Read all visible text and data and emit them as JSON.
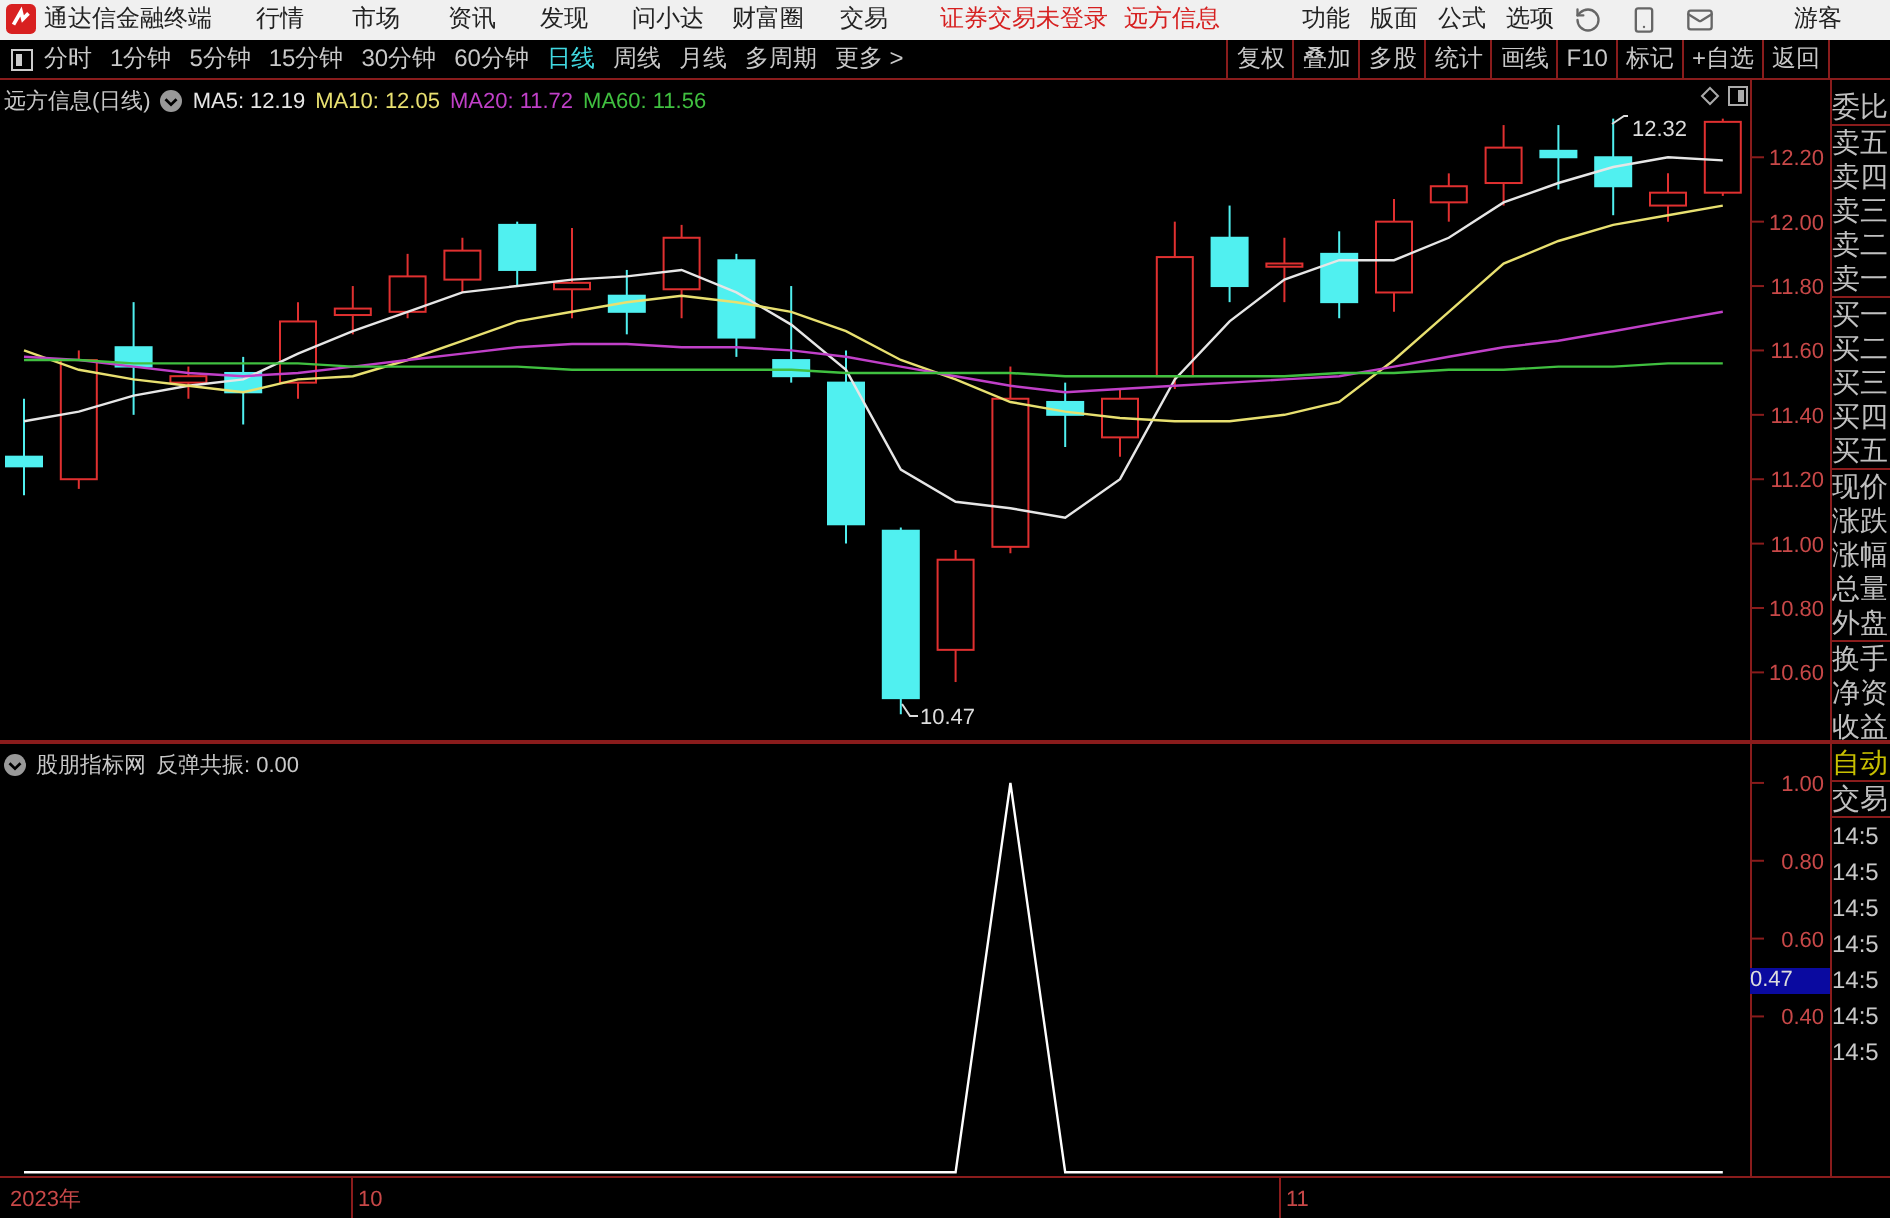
{
  "app": {
    "title": "通达信金融终端"
  },
  "menu": [
    "行情",
    "市场",
    "资讯",
    "发现",
    "问小达",
    "财富圈",
    "交易"
  ],
  "notices": [
    "证券交易未登录",
    "远方信息"
  ],
  "right_menu": [
    "功能",
    "版面",
    "公式",
    "选项"
  ],
  "user": "游客",
  "periods": [
    {
      "label": "分时",
      "selected": false
    },
    {
      "label": "1分钟",
      "selected": false
    },
    {
      "label": "5分钟",
      "selected": false
    },
    {
      "label": "15分钟",
      "selected": false
    },
    {
      "label": "30分钟",
      "selected": false
    },
    {
      "label": "60分钟",
      "selected": false
    },
    {
      "label": "日线",
      "selected": true
    },
    {
      "label": "周线",
      "selected": false
    },
    {
      "label": "月线",
      "selected": false
    },
    {
      "label": "多周期",
      "selected": false
    },
    {
      "label": "更多 >",
      "selected": false
    }
  ],
  "tools": [
    "复权",
    "叠加",
    "多股",
    "统计",
    "画线",
    "F10",
    "标记",
    "+自选",
    "返回"
  ],
  "chart": {
    "title": "远方信息(日线)",
    "high_label": "12.32",
    "low_label": "10.47",
    "chart_data": {
      "type": "line",
      "ylim": [
        10.39,
        12.44
      ],
      "yticks": [
        {
          "value": 12.2,
          "label": "12.20"
        },
        {
          "value": 12.0,
          "label": "12.00"
        },
        {
          "value": 11.8,
          "label": "11.80"
        },
        {
          "value": 11.6,
          "label": "11.60"
        },
        {
          "value": 11.4,
          "label": "11.40"
        },
        {
          "value": 11.2,
          "label": "11.20"
        },
        {
          "value": 11.0,
          "label": "11.00"
        },
        {
          "value": 10.8,
          "label": "10.80"
        },
        {
          "value": 10.6,
          "label": "10.60"
        }
      ],
      "series": [
        {
          "name": "MA5: 12.19",
          "color": "#e6e6e6",
          "values": [
            11.38,
            11.41,
            11.46,
            11.49,
            11.51,
            11.59,
            11.66,
            11.72,
            11.78,
            11.8,
            11.82,
            11.83,
            11.85,
            11.78,
            11.68,
            11.54,
            11.23,
            11.13,
            11.11,
            11.08,
            11.2,
            11.51,
            11.69,
            11.82,
            11.88,
            11.88,
            11.95,
            12.06,
            12.12,
            12.17,
            12.2,
            12.19
          ]
        },
        {
          "name": "MA10: 12.05",
          "color": "#e8e070",
          "values": [
            11.6,
            11.54,
            11.51,
            11.49,
            11.47,
            11.51,
            11.52,
            11.57,
            11.63,
            11.69,
            11.72,
            11.75,
            11.77,
            11.75,
            11.72,
            11.66,
            11.57,
            11.51,
            11.44,
            11.41,
            11.39,
            11.38,
            11.38,
            11.4,
            11.44,
            11.57,
            11.72,
            11.87,
            11.94,
            11.99,
            12.02,
            12.05
          ]
        },
        {
          "name": "MA20: 11.72",
          "color": "#c040c8",
          "values": [
            11.58,
            11.57,
            11.55,
            11.53,
            11.52,
            11.53,
            11.55,
            11.57,
            11.59,
            11.61,
            11.62,
            11.62,
            11.61,
            11.61,
            11.6,
            11.58,
            11.55,
            11.52,
            11.49,
            11.47,
            11.48,
            11.49,
            11.5,
            11.51,
            11.52,
            11.55,
            11.58,
            11.61,
            11.63,
            11.66,
            11.69,
            11.72
          ]
        },
        {
          "name": "MA60: 11.56",
          "color": "#40c040",
          "values": [
            11.57,
            11.57,
            11.56,
            11.56,
            11.56,
            11.56,
            11.55,
            11.55,
            11.55,
            11.55,
            11.54,
            11.54,
            11.54,
            11.54,
            11.54,
            11.53,
            11.53,
            11.53,
            11.53,
            11.52,
            11.52,
            11.52,
            11.52,
            11.52,
            11.53,
            11.53,
            11.54,
            11.54,
            11.55,
            11.55,
            11.56,
            11.56
          ]
        }
      ]
    }
  },
  "indicator": {
    "source": "股朋指标网",
    "cursor_value": "0.47",
    "chart_data": {
      "type": "line",
      "ylim": [
        -0.01,
        1.1
      ],
      "yticks": [
        {
          "value": 1,
          "label": "1.00"
        },
        {
          "value": 0.8,
          "label": "0.80"
        },
        {
          "value": 0.6,
          "label": "0.60"
        },
        {
          "value": 0.4,
          "label": "0.40"
        }
      ],
      "series": [
        {
          "name": "反弹共振: 0.00",
          "color": "#ffffff",
          "values": [
            0,
            0,
            0,
            0,
            0,
            0,
            0,
            0,
            0,
            0,
            0,
            0,
            0,
            0,
            0,
            0,
            0,
            0,
            1,
            0,
            0,
            0,
            0,
            0,
            0,
            0,
            0,
            0,
            0,
            0,
            0,
            0
          ]
        }
      ]
    }
  },
  "date_axis": [
    "2023年",
    "10",
    "11"
  ],
  "quote_panel": {
    "groups": [
      [
        "委比"
      ],
      [
        "卖五",
        "卖四",
        "卖三",
        "卖二",
        "卖一"
      ],
      [
        "买一",
        "买二",
        "买三",
        "买四",
        "买五"
      ],
      [
        "现价",
        "涨跌",
        "涨幅",
        "总量",
        "外盘"
      ],
      [
        "换手",
        "净资",
        "收益"
      ]
    ]
  },
  "trade_panel": {
    "title": "自动",
    "header": "交易",
    "times": [
      "14:5",
      "14:5",
      "14:5",
      "14:5",
      "14:5",
      "14:5",
      "14:5"
    ]
  }
}
